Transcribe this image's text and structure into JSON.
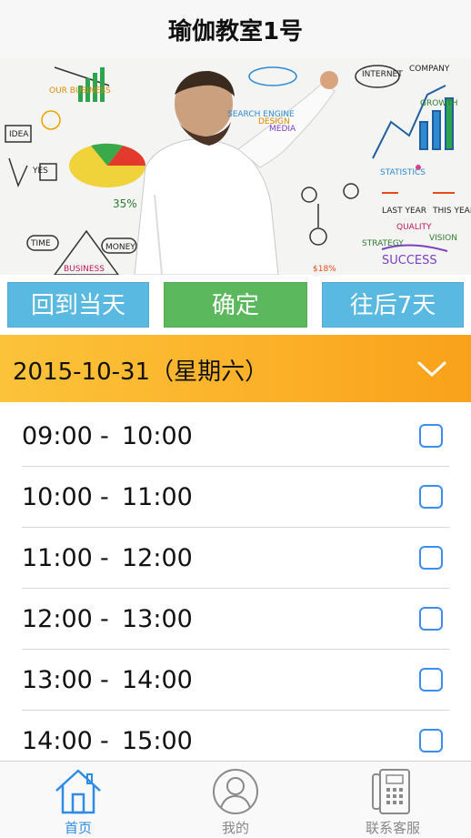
{
  "header": {
    "title": "瑜伽教室1号"
  },
  "banner": {
    "sketch_words": [
      "OUR BUSINESS",
      "IDEA",
      "YES",
      "TIME",
      "MONEY",
      "BUSINESS",
      "SEARCH ENGINE",
      "DESIGN",
      "MEDIA",
      "INTERNET",
      "COMPANY",
      "GROWTH",
      "STATISTICS",
      "LAST YEAR",
      "THIS YEAR",
      "QUALITY",
      "VISION",
      "STRATEGY",
      "SUCCESS",
      "$18%",
      "35%"
    ]
  },
  "actions": {
    "today_label": "回到当天",
    "confirm_label": "确定",
    "next_label": "往后7天"
  },
  "date_bar": {
    "date_text": "2015-10-31（星期六）",
    "icon": "chevron-down-icon"
  },
  "slots": [
    {
      "start": "09:00",
      "end": "10:00",
      "checked": false
    },
    {
      "start": "10:00",
      "end": "11:00",
      "checked": false
    },
    {
      "start": "11:00",
      "end": "12:00",
      "checked": false
    },
    {
      "start": "12:00",
      "end": "13:00",
      "checked": false
    },
    {
      "start": "13:00",
      "end": "14:00",
      "checked": false
    },
    {
      "start": "14:00",
      "end": "15:00",
      "checked": false
    }
  ],
  "tabs": [
    {
      "label": "首页",
      "icon": "home-icon",
      "active": true
    },
    {
      "label": "我的",
      "icon": "user-icon",
      "active": false
    },
    {
      "label": "联系客服",
      "icon": "phone-icon",
      "active": false
    }
  ],
  "colors": {
    "accent_blue": "#5ab9e0",
    "confirm_green": "#5cb85c",
    "date_bar": "#fbb028",
    "tab_active": "#2f8be6"
  }
}
